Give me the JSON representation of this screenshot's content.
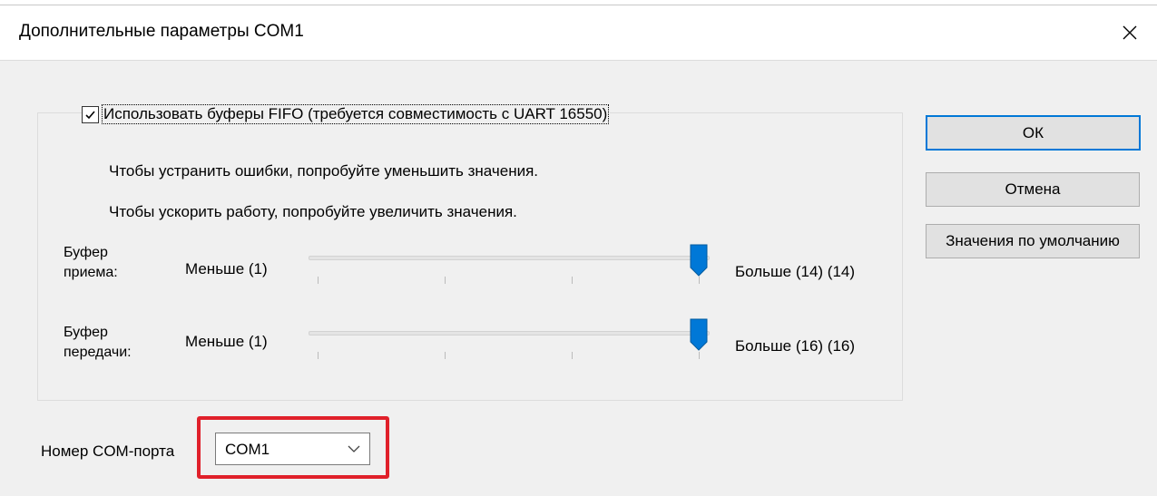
{
  "window": {
    "title": "Дополнительные параметры COM1"
  },
  "fifo": {
    "checked": true,
    "label": "Использовать буферы FIFO (требуется совместимость с UART 16550)"
  },
  "hints": [
    "Чтобы устранить ошибки, попробуйте уменьшить значения.",
    "Чтобы ускорить работу, попробуйте увеличить значения."
  ],
  "receive": {
    "label_line1": "Буфер",
    "label_line2": "приема:",
    "min": "Меньше (1)",
    "max": "Больше (14)",
    "value": "(14)",
    "level": 1.0
  },
  "transmit": {
    "label_line1": "Буфер",
    "label_line2": "передачи:",
    "min": "Меньше (1)",
    "max": "Больше (16)",
    "value": "(16)",
    "level": 1.0
  },
  "buttons": {
    "ok": "ОК",
    "cancel": "Отмена",
    "defaults": "Значения по умолчанию"
  },
  "port": {
    "label": "Номер COM-порта",
    "value": "COM1"
  },
  "colors": {
    "accent": "#0078d7",
    "highlight": "#e0202a"
  },
  "icons": {
    "close": "close-icon",
    "checkbox": "checkmark-icon",
    "dropdown": "chevron-down-icon"
  }
}
